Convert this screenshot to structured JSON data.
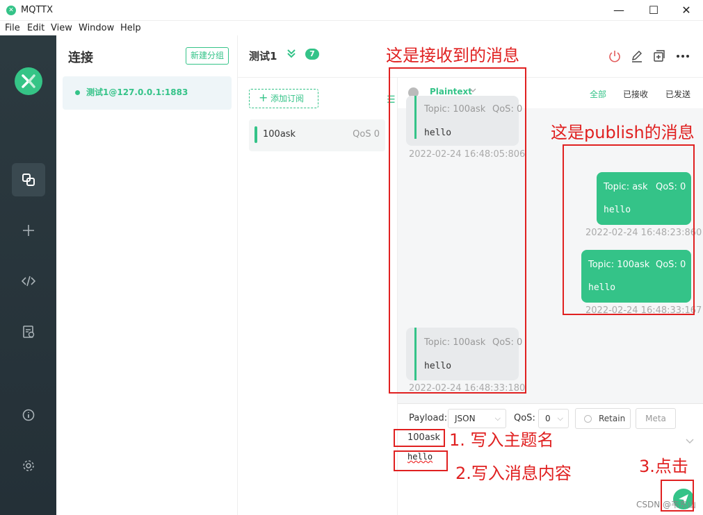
{
  "window": {
    "title": "MQTTX",
    "logo_glyph": "✕",
    "controls": {
      "minimize": "—",
      "maximize": "☐",
      "close": "✕"
    }
  },
  "menu": {
    "items": [
      "File",
      "Edit",
      "View",
      "Window",
      "Help"
    ]
  },
  "nav": {
    "items": [
      {
        "name": "connections-icon",
        "active": true
      },
      {
        "name": "plus-icon",
        "active": false
      },
      {
        "name": "code-icon",
        "active": false
      },
      {
        "name": "log-icon",
        "active": false
      },
      {
        "name": "info-icon",
        "active": false
      },
      {
        "name": "gear-icon",
        "active": false
      }
    ]
  },
  "connections": {
    "title": "连接",
    "new_group_label": "新建分组",
    "items": [
      {
        "name": "测试1@127.0.0.1:1883",
        "status": "connected"
      }
    ]
  },
  "header": {
    "connection_name": "测试1",
    "message_count": "7"
  },
  "subscriptions": {
    "add_label": "添加订阅",
    "items": [
      {
        "topic": "100ask",
        "qos": "QoS 0"
      }
    ]
  },
  "messages": {
    "format": "Plaintext",
    "filters": [
      "全部",
      "已接收",
      "已发送"
    ],
    "active_filter": "全部",
    "received": [
      {
        "topic": "Topic: 100ask",
        "qos": "QoS: 0",
        "payload": "hello",
        "time": "2022-02-24 16:48:05:806"
      },
      {
        "topic": "Topic: 100ask",
        "qos": "QoS: 0",
        "payload": "hello",
        "time": "2022-02-24 16:48:33:180"
      }
    ],
    "sent": [
      {
        "topic": "Topic: ask",
        "qos": "QoS: 0",
        "payload": "hello",
        "time": "2022-02-24 16:48:23:860"
      },
      {
        "topic": "Topic: 100ask",
        "qos": "QoS: 0",
        "payload": "hello",
        "time": "2022-02-24 16:48:33:167"
      }
    ]
  },
  "compose": {
    "payload_label": "Payload:",
    "payload_format": "JSON",
    "qos_label": "QoS:",
    "qos_value": "0",
    "retain_label": "Retain",
    "meta_label": "Meta",
    "topic_value": "100ask",
    "payload_value": "hello"
  },
  "annotations": {
    "received_label": "这是接收到的消息",
    "publish_label": "这是publish的消息",
    "step1": "1. 写入主题名",
    "step2": "2.写入消息内容",
    "step3": "3.点击",
    "color": "#e02020"
  },
  "watermark": "CSDN @韦东山",
  "colors": {
    "accent": "#34c388",
    "nav_bg": "#2c3a40",
    "annotation": "#e02020"
  }
}
